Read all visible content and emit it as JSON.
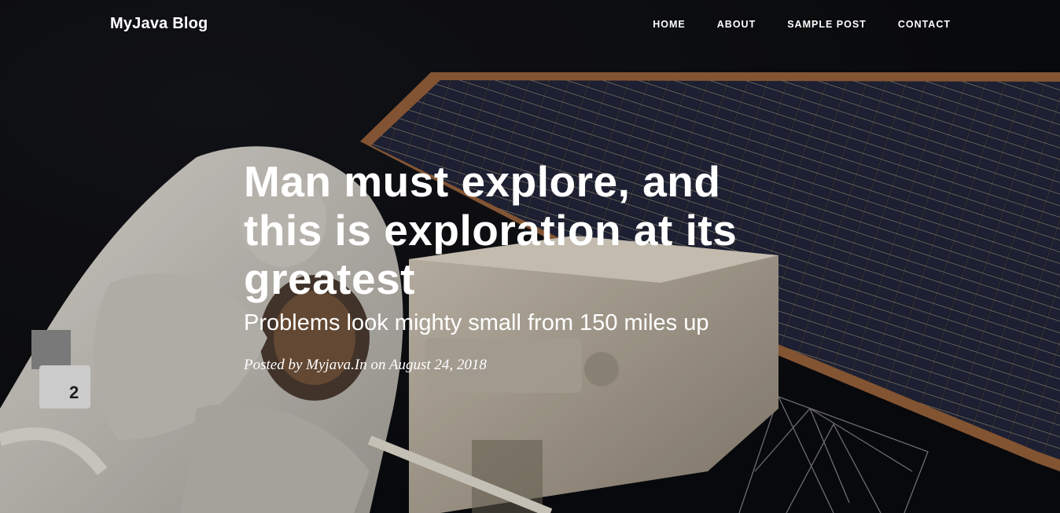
{
  "navbar": {
    "brand": "MyJava Blog",
    "links": [
      "HOME",
      "ABOUT",
      "SAMPLE POST",
      "CONTACT"
    ]
  },
  "post": {
    "title": "Man must explore, and this is exploration at its greatest",
    "subtitle": "Problems look mighty small from 150 miles up",
    "meta_prefix": "Posted by",
    "author": "Myjava.In",
    "meta_on": "on",
    "date": "August 24, 2018"
  },
  "hero_image": {
    "description_icon": "astronaut-spacewalk-image",
    "suit_number": "2"
  },
  "colors": {
    "background": "#0c0d10",
    "text": "#ffffff",
    "solar_panel": "#1b1d26",
    "panel_frame": "#a9714a",
    "suit": "#d9d6cf"
  }
}
